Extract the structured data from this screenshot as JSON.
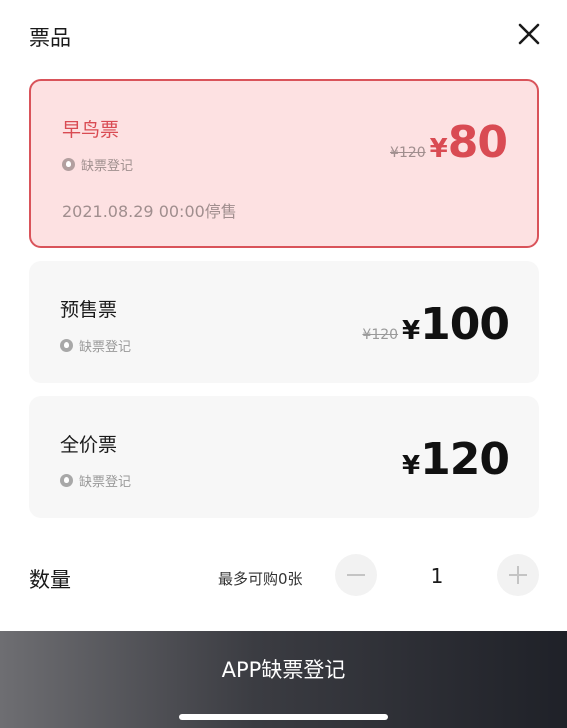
{
  "header": {
    "title": "票品"
  },
  "tickets": [
    {
      "name": "早鸟票",
      "register": "缺票登记",
      "stop_time": "2021.08.29 00:00停售",
      "original_price": "¥120",
      "currency": "¥",
      "price": "80",
      "selected": true
    },
    {
      "name": "预售票",
      "register": "缺票登记",
      "original_price": "¥120",
      "currency": "¥",
      "price": "100",
      "selected": false
    },
    {
      "name": "全价票",
      "register": "缺票登记",
      "currency": "¥",
      "price": "120",
      "selected": false
    }
  ],
  "quantity": {
    "label": "数量",
    "limit_text": "最多可购0张",
    "value": "1"
  },
  "footer": {
    "button_label": "APP缺票登记"
  },
  "colors": {
    "accent": "#d94b53",
    "selected_bg": "#fde1e2",
    "card_bg": "#f7f7f7"
  },
  "icons": {
    "close": "close-icon",
    "register": "bell-icon",
    "minus": "minus-icon",
    "plus": "plus-icon"
  }
}
